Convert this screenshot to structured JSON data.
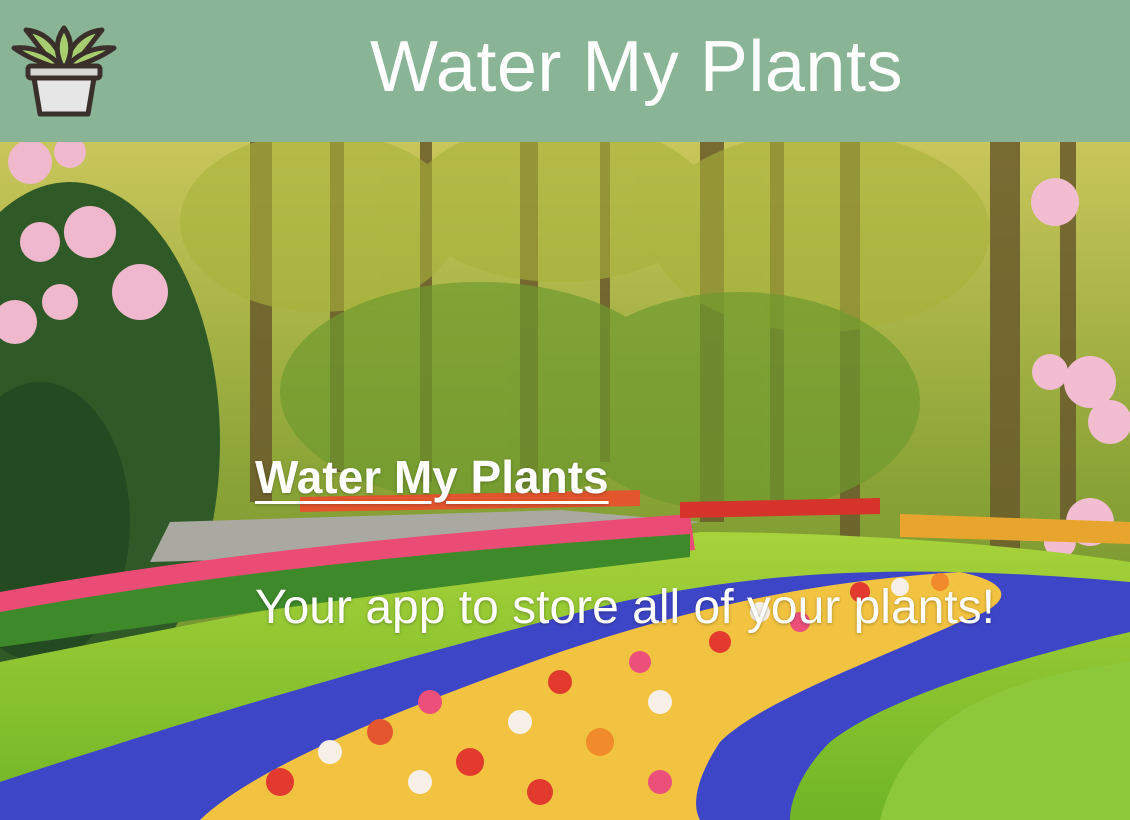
{
  "header": {
    "title": "Water My Plants",
    "logo_icon": "potted-plant-icon",
    "background_color": "#89b596"
  },
  "hero": {
    "heading": "Water My Plants",
    "tagline": "Your app to store all of your plants!",
    "background_image": "tulip-garden-park-photo"
  }
}
